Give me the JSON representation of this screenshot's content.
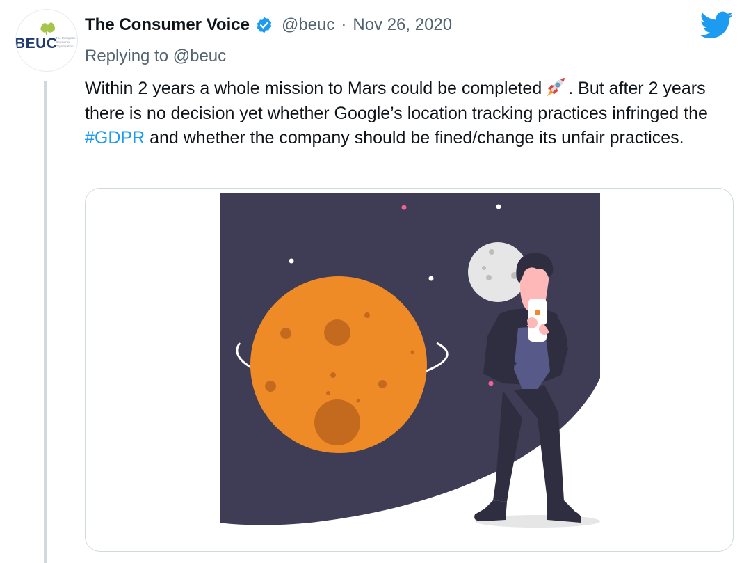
{
  "tweet": {
    "author": {
      "display_name": "The Consumer Voice",
      "handle": "@beuc",
      "verified": true,
      "avatar": {
        "logo_text": "BEUC",
        "tagline_lines": [
          "The European",
          "Consumer",
          "Organisation"
        ],
        "accent_color": "#a5c64a",
        "logo_color": "#1f3a6e"
      }
    },
    "separator": "·",
    "date": "Nov 26, 2020",
    "replying_to": "Replying to @beuc",
    "text": {
      "part1": "Within 2 years a whole mission to Mars could be completed",
      "emoji": "rocket",
      "part2": ". But after 2 years there is no decision yet whether Google’s location tracking practices infringed the ",
      "hashtag": "#GDPR",
      "part3": " and whether the company should be fined/change its unfair practices."
    },
    "media": {
      "type": "illustration",
      "alt": "",
      "colors": {
        "space": "#3f3d56",
        "planet": "#ef8b26",
        "crater": "#c46a1f",
        "moon": "#e6e6e6",
        "star_pink": "#f06292",
        "star_white": "#ffffff"
      }
    }
  },
  "icons": {
    "verified": "verified-badge-icon",
    "brand": "twitter-bird-icon",
    "emoji": "rocket-emoji-icon"
  },
  "colors": {
    "link": "#1d9bf0",
    "muted": "#536471",
    "text": "#0f1419",
    "thread_line": "#cfd9de"
  }
}
